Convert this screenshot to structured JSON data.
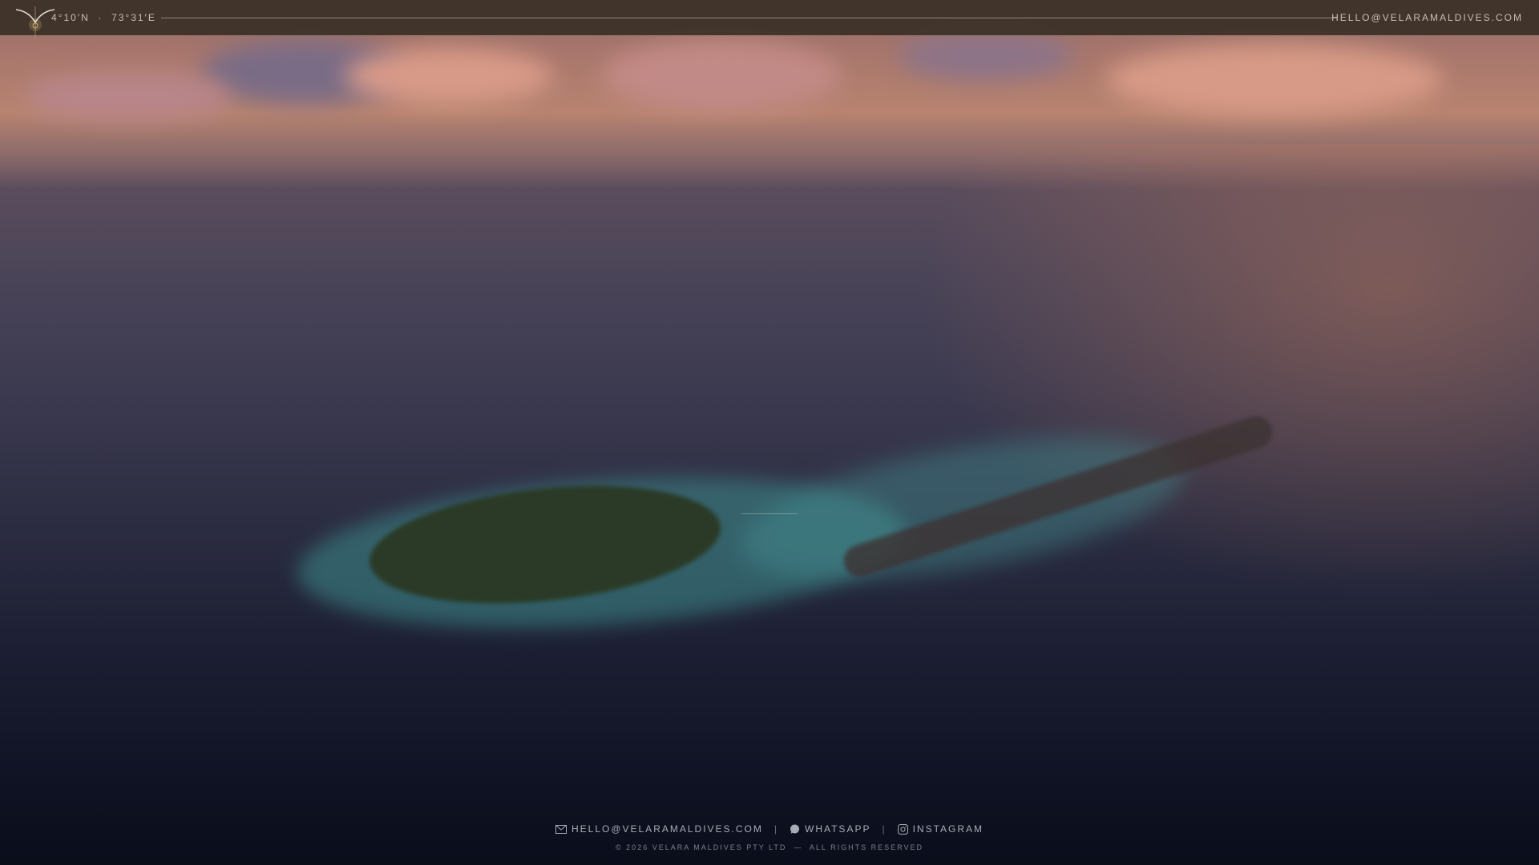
{
  "header": {
    "coordinates": "4°10′N  ·  73°31′E",
    "email": "HELLO@VELARAMALDIVES.COM"
  },
  "footer": {
    "links": [
      {
        "icon": "mail-icon",
        "label": "HELLO@VELARAMALDIVES.COM"
      },
      {
        "icon": "whatsapp-icon",
        "label": "WHATSAPP"
      },
      {
        "icon": "instagram-icon",
        "label": "INSTAGRAM"
      }
    ],
    "separator": "|",
    "copyright": "© 2026 VELARA MALDIVES PTY LTD  —  ALL RIGHTS RESERVED"
  }
}
